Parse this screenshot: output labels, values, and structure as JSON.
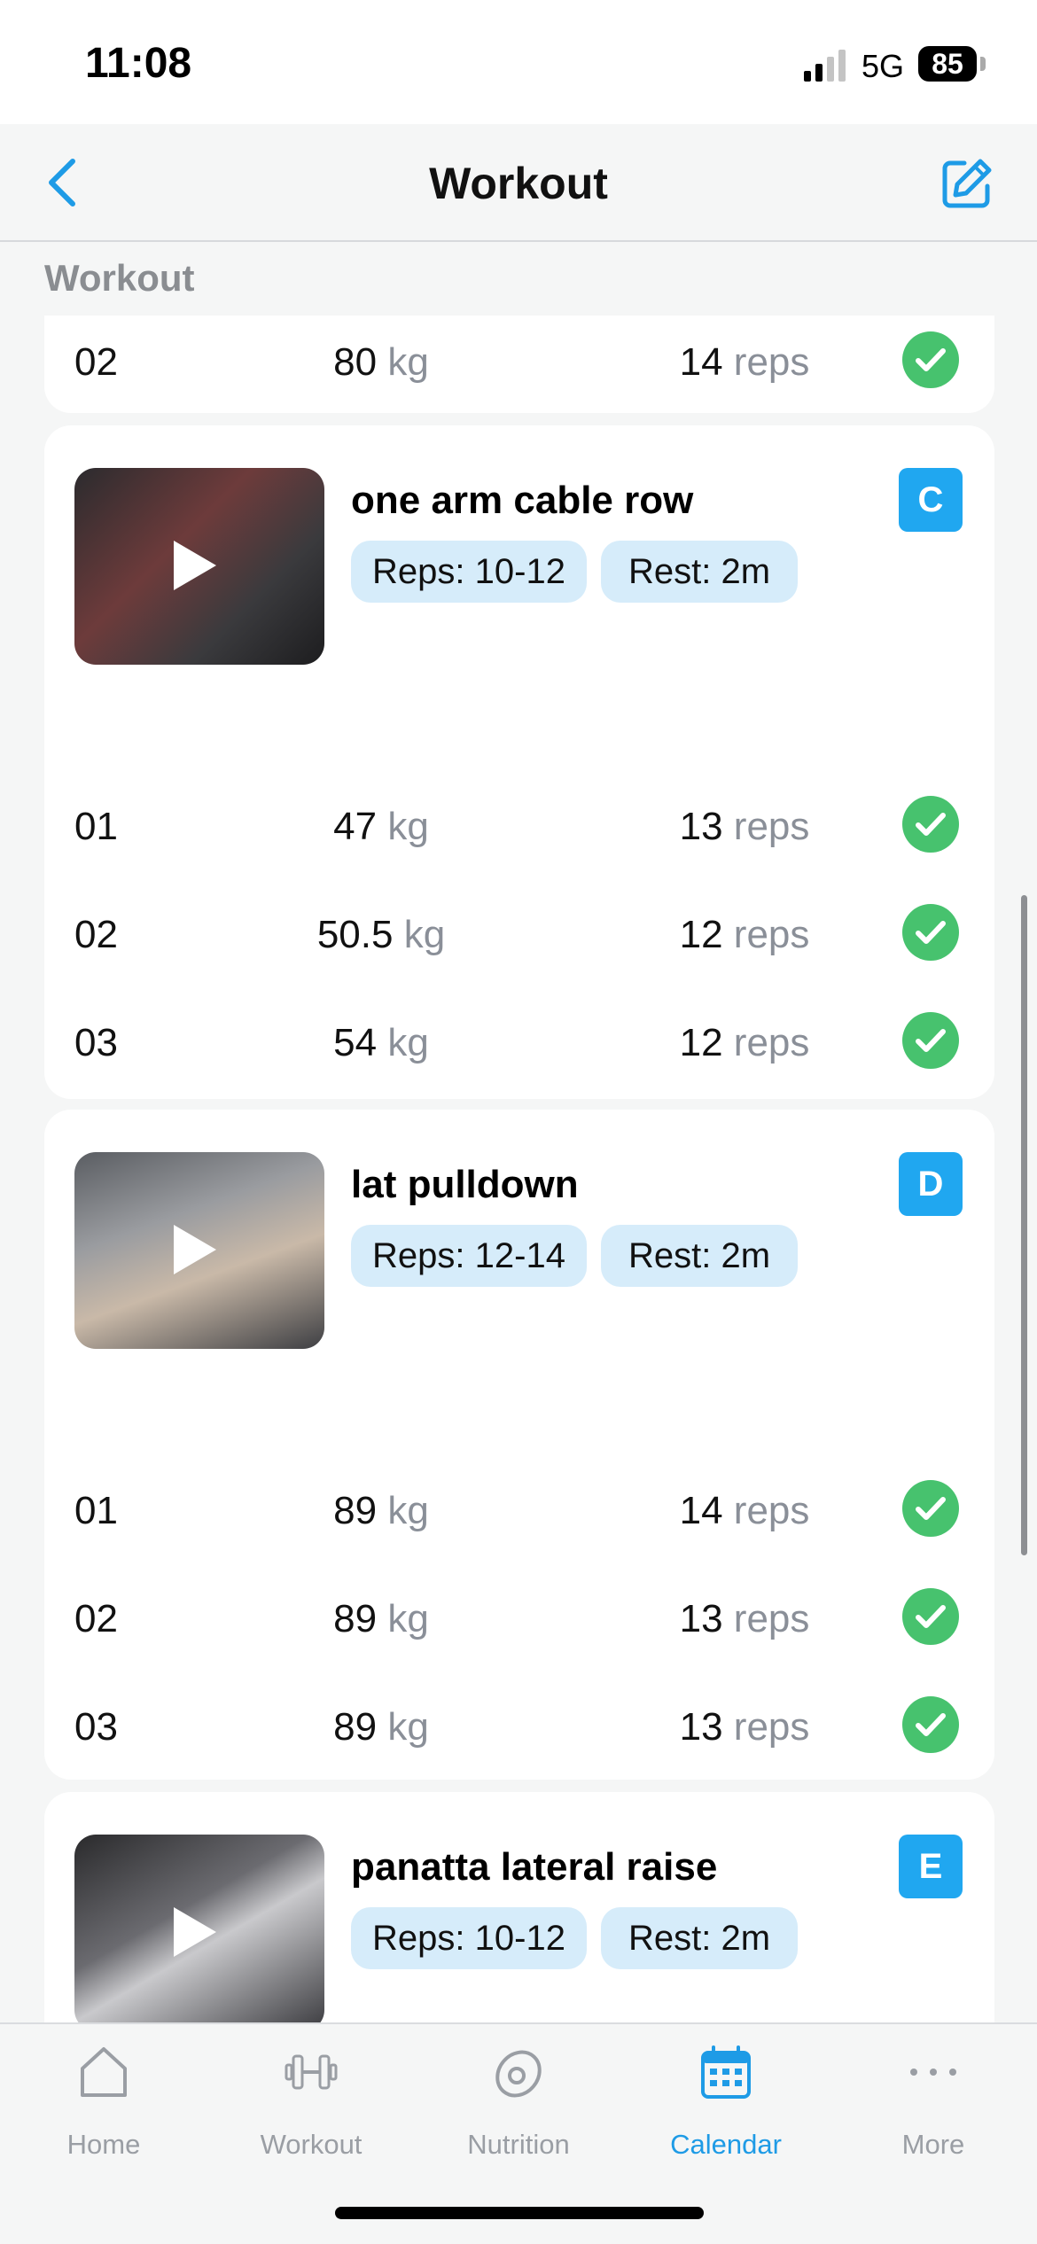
{
  "status": {
    "time": "11:08",
    "network": "5G",
    "battery": "85"
  },
  "nav": {
    "title": "Workout"
  },
  "section_label": "Workout",
  "units": {
    "weight": "kg",
    "reps": "reps"
  },
  "partial_card": {
    "set": {
      "num": "02",
      "weight": "80",
      "reps": "14"
    }
  },
  "exercises": [
    {
      "name": "one arm cable row",
      "reps_pill": "Reps: 10-12",
      "rest_pill": "Rest: 2m",
      "badge": "C",
      "sets": [
        {
          "num": "01",
          "weight": "47",
          "reps": "13"
        },
        {
          "num": "02",
          "weight": "50.5",
          "reps": "12"
        },
        {
          "num": "03",
          "weight": "54",
          "reps": "12"
        }
      ]
    },
    {
      "name": "lat pulldown",
      "reps_pill": "Reps: 12-14",
      "rest_pill": "Rest: 2m",
      "badge": "D",
      "sets": [
        {
          "num": "01",
          "weight": "89",
          "reps": "14"
        },
        {
          "num": "02",
          "weight": "89",
          "reps": "13"
        },
        {
          "num": "03",
          "weight": "89",
          "reps": "13"
        }
      ]
    },
    {
      "name": "panatta lateral raise",
      "reps_pill": "Reps: 10-12",
      "rest_pill": "Rest: 2m",
      "badge": "E",
      "sets": []
    }
  ],
  "tabs": [
    {
      "label": "Home",
      "icon": "home-icon"
    },
    {
      "label": "Workout",
      "icon": "dumbbell-icon"
    },
    {
      "label": "Nutrition",
      "icon": "avocado-icon"
    },
    {
      "label": "Calendar",
      "icon": "calendar-icon",
      "active": true
    },
    {
      "label": "More",
      "icon": "more-icon"
    }
  ],
  "colors": {
    "accent": "#1e9be6",
    "check": "#47c26e",
    "pill": "#d6ecfa",
    "badge": "#20a7f0"
  }
}
